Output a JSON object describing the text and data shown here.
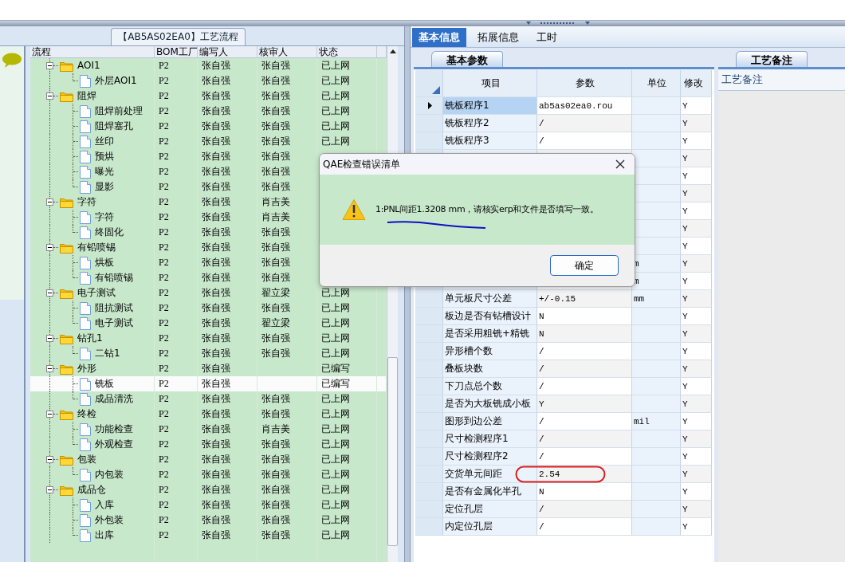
{
  "process_panel": {
    "title": "【AB5AS02EA0】工艺流程",
    "columns": [
      "流程",
      "BOM工厂",
      "编写人",
      "核审人",
      "状态"
    ],
    "rows": [
      {
        "name": "AOI1",
        "bom": "P2",
        "writer": "张自强",
        "reviewer": "张自强",
        "status": "已上网",
        "selected": false,
        "expanded": true,
        "children": [
          {
            "name": "外层AOI1",
            "bom": "P2",
            "writer": "张自强",
            "reviewer": "张自强",
            "status": "已上网",
            "selected": false
          }
        ]
      },
      {
        "name": "阻焊",
        "bom": "P2",
        "writer": "张自强",
        "reviewer": "张自强",
        "status": "已上网",
        "selected": false,
        "expanded": true,
        "children": [
          {
            "name": "阻焊前处理",
            "bom": "P2",
            "writer": "张自强",
            "reviewer": "张自强",
            "status": "已上网",
            "selected": false
          },
          {
            "name": "阻焊塞孔",
            "bom": "P2",
            "writer": "张自强",
            "reviewer": "张自强",
            "status": "已上网",
            "selected": false
          },
          {
            "name": "丝印",
            "bom": "P2",
            "writer": "张自强",
            "reviewer": "张自强",
            "status": "已上网",
            "selected": false
          },
          {
            "name": "预烘",
            "bom": "P2",
            "writer": "张自强",
            "reviewer": "张自强",
            "selected": false
          },
          {
            "name": "曝光",
            "bom": "P2",
            "writer": "张自强",
            "reviewer": "张自强",
            "selected": false
          },
          {
            "name": "显影",
            "bom": "P2",
            "writer": "张自强",
            "reviewer": "张自强",
            "selected": false
          }
        ]
      },
      {
        "name": "字符",
        "bom": "P2",
        "writer": "张自强",
        "reviewer": "肖吉美",
        "selected": false,
        "expanded": true,
        "children": [
          {
            "name": "字符",
            "bom": "P2",
            "writer": "张自强",
            "reviewer": "肖吉美",
            "selected": false
          },
          {
            "name": "终固化",
            "bom": "P2",
            "writer": "张自强",
            "reviewer": "张自强",
            "selected": false
          }
        ]
      },
      {
        "name": "有铅喷锡",
        "bom": "P2",
        "writer": "张自强",
        "reviewer": "张自强",
        "selected": false,
        "expanded": true,
        "children": [
          {
            "name": "烘板",
            "bom": "P2",
            "writer": "张自强",
            "reviewer": "张自强",
            "selected": false
          },
          {
            "name": "有铅喷锡",
            "bom": "P2",
            "writer": "张自强",
            "reviewer": "张自强",
            "selected": false
          }
        ]
      },
      {
        "name": "电子测试",
        "bom": "P2",
        "writer": "张自强",
        "reviewer": "翟立梁",
        "status": "已上网",
        "selected": false,
        "expanded": true,
        "children": [
          {
            "name": "阻抗测试",
            "bom": "P2",
            "writer": "张自强",
            "reviewer": "张自强",
            "status": "已上网",
            "selected": false
          },
          {
            "name": "电子测试",
            "bom": "P2",
            "writer": "张自强",
            "reviewer": "翟立梁",
            "status": "已上网",
            "selected": false
          }
        ]
      },
      {
        "name": "钻孔1",
        "bom": "P2",
        "writer": "张自强",
        "reviewer": "张自强",
        "status": "已上网",
        "selected": false,
        "expanded": true,
        "children": [
          {
            "name": "二钻1",
            "bom": "P2",
            "writer": "张自强",
            "reviewer": "张自强",
            "status": "已上网",
            "selected": false
          }
        ]
      },
      {
        "name": "外形",
        "bom": "P2",
        "writer": "张自强",
        "status": "已编写",
        "selected": false,
        "expanded": true,
        "children": [
          {
            "name": "铣板",
            "bom": "P2",
            "writer": "张自强",
            "status": "已编写",
            "selected": true
          },
          {
            "name": "成品清洗",
            "bom": "P2",
            "writer": "张自强",
            "reviewer": "张自强",
            "status": "已上网",
            "selected": false
          }
        ]
      },
      {
        "name": "终检",
        "bom": "P2",
        "writer": "张自强",
        "reviewer": "张自强",
        "status": "已上网",
        "selected": false,
        "expanded": true,
        "children": [
          {
            "name": "功能检查",
            "bom": "P2",
            "writer": "张自强",
            "reviewer": "肖吉美",
            "status": "已上网",
            "selected": false
          },
          {
            "name": "外观检查",
            "bom": "P2",
            "writer": "张自强",
            "reviewer": "张自强",
            "status": "已上网",
            "selected": false
          }
        ]
      },
      {
        "name": "包装",
        "bom": "P2",
        "writer": "张自强",
        "reviewer": "张自强",
        "status": "已上网",
        "selected": false,
        "expanded": true,
        "children": [
          {
            "name": "内包装",
            "bom": "P2",
            "writer": "张自强",
            "reviewer": "张自强",
            "status": "已上网",
            "selected": false
          }
        ]
      },
      {
        "name": "成品仓",
        "bom": "P2",
        "writer": "张自强",
        "reviewer": "张自强",
        "status": "已上网",
        "selected": false,
        "expanded": true,
        "children": [
          {
            "name": "入库",
            "bom": "P2",
            "writer": "张自强",
            "reviewer": "张自强",
            "status": "已上网",
            "selected": false
          },
          {
            "name": "外包装",
            "bom": "P2",
            "writer": "张自强",
            "reviewer": "张自强",
            "status": "已上网",
            "selected": false
          },
          {
            "name": "出库",
            "bom": "P2",
            "writer": "张自强",
            "reviewer": "张自强",
            "status": "已上网",
            "selected": false
          }
        ]
      }
    ]
  },
  "tabs": [
    {
      "label": "基本信息",
      "selected": true
    },
    {
      "label": "拓展信息",
      "selected": false
    },
    {
      "label": "工时",
      "selected": false
    }
  ],
  "params": {
    "tab": "基本参数",
    "columns": [
      "项目",
      "参数",
      "单位",
      "修改"
    ],
    "rows": [
      {
        "item": "铣板程序1",
        "value": "ab5as02ea0.rou",
        "modify": "Y",
        "selected": true,
        "circled": false
      },
      {
        "item": "铣板程序2",
        "value": "/",
        "modify": "Y",
        "selected": false,
        "circled": false
      },
      {
        "item": "铣板程序3",
        "value": "/",
        "modify": "Y",
        "selected": false,
        "circled": false
      },
      {
        "modify": "Y",
        "selected": false,
        "circled": false
      },
      {
        "modify": "Y",
        "selected": false,
        "circled": false
      },
      {
        "modify": "Y",
        "selected": false,
        "circled": false
      },
      {
        "modify": "Y",
        "selected": false,
        "circled": false
      },
      {
        "modify": "Y",
        "selected": false,
        "circled": false
      },
      {
        "modify": "Y",
        "selected": false,
        "circled": false
      },
      {
        "unit": "m",
        "modify": "Y",
        "selected": false,
        "circled": false
      },
      {
        "unit": "m",
        "modify": "Y",
        "selected": false,
        "circled": false
      },
      {
        "item": "单元板尺寸公差",
        "value": "+/-0.15",
        "unit": "mm",
        "modify": "Y",
        "selected": false,
        "circled": false
      },
      {
        "item": "板边是否有钻槽设计",
        "value": "N",
        "modify": "Y",
        "selected": false,
        "circled": false
      },
      {
        "item": "是否采用粗铣+精铣",
        "value": "N",
        "modify": "Y",
        "selected": false,
        "circled": false
      },
      {
        "item": "异形槽个数",
        "value": "/",
        "modify": "Y",
        "selected": false,
        "circled": false
      },
      {
        "item": "叠板块数",
        "value": "/",
        "modify": "Y",
        "selected": false,
        "circled": false
      },
      {
        "item": "下刀点总个数",
        "value": "/",
        "modify": "Y",
        "selected": false,
        "circled": false
      },
      {
        "item": "是否为大板铣成小板",
        "value": "Y",
        "modify": "Y",
        "selected": false,
        "circled": false
      },
      {
        "item": "图形到边公差",
        "value": "/",
        "unit": "mil",
        "modify": "Y",
        "selected": false,
        "circled": false
      },
      {
        "item": "尺寸检测程序1",
        "value": "/",
        "modify": "Y",
        "selected": false,
        "circled": false
      },
      {
        "item": "尺寸检测程序2",
        "value": "/",
        "modify": "Y",
        "selected": false,
        "circled": false
      },
      {
        "item": "交货单元间距",
        "value": "2.54",
        "modify": "Y",
        "selected": false,
        "circled": true
      },
      {
        "item": "是否有金属化半孔",
        "value": "N",
        "modify": "Y",
        "selected": false,
        "circled": false
      },
      {
        "item": "定位孔层",
        "value": "/",
        "modify": "Y",
        "selected": false,
        "circled": false
      },
      {
        "item": "内定位孔层",
        "value": "/",
        "modify": "Y",
        "selected": false,
        "circled": false
      }
    ]
  },
  "notes": {
    "tab": "工艺备注",
    "label": "工艺备注"
  },
  "dialog": {
    "title": "QAE检查错误清单",
    "message": "1:PNL间距1.3208 mm，请核实erp和文件是否填写一致。",
    "ok_button": "确定"
  }
}
